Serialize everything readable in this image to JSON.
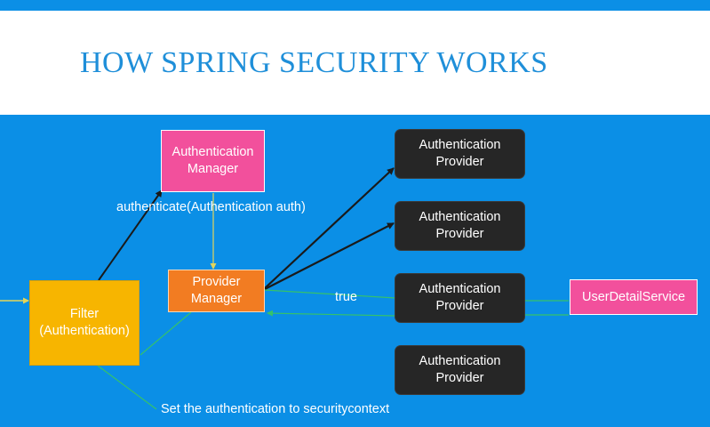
{
  "title": "HOW SPRING SECURITY WORKS",
  "nodes": {
    "authentication_manager": "Authentication Manager",
    "provider_manager": "Provider Manager",
    "filter": "Filter (Authentication)",
    "authentication_providers": [
      "Authentication Provider",
      "Authentication Provider",
      "Authentication Provider",
      "Authentication Provider"
    ],
    "user_detail_service": "UserDetailService"
  },
  "edge_labels": {
    "authenticate": "authenticate(Authentication auth)",
    "true_label": "true",
    "set_context": "Set the authentication to securitycontext"
  },
  "colors": {
    "background": "#0b8fe6",
    "title": "#1f8fd9",
    "manager": "#f2509c",
    "provider_manager": "#f27c22",
    "filter": "#f7b500",
    "provider": "#262626",
    "green_line": "#35c26a",
    "yellow_line": "#e3d55a"
  }
}
